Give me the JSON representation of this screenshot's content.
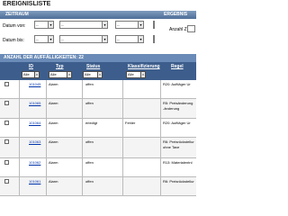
{
  "page_title": "EREIGNISLISTE",
  "filter_bar": {
    "label": "ZEITRAUM",
    "button_label": "",
    "right_label": "ERGEBNIS"
  },
  "date_filter": {
    "from_label": "Datum von:",
    "to_label": "Datum bis:",
    "select_placeholder": "--",
    "anzahl_label": "Anzahl Ze"
  },
  "section": {
    "title": "ANZAHL DER AUFFÄLLIGKEITEN: 22"
  },
  "table": {
    "headers": {
      "id": "ID",
      "typ": "Typ",
      "status": "Status",
      "klassifizierung": "Klassifizierung",
      "regel": "Regel"
    },
    "header_selects": {
      "id": "Alle",
      "typ": "Alle",
      "status": "Alle",
      "klassifizierung": "Alle"
    },
    "rows": [
      {
        "id": "101045",
        "typ": "Alarm",
        "status": "offen",
        "klass": "",
        "regel": "R20: Auftläger Ur",
        "regel2": ""
      },
      {
        "id": "101065",
        "typ": "Alarm",
        "status": "offen",
        "klass": "",
        "regel": "R5: Preisänderung",
        "regel2": "-änderung"
      },
      {
        "id": "101064",
        "typ": "Alarm",
        "status": "erledigt",
        "klass": "Fehler",
        "regel": "R20: Auftläger Ur",
        "regel2": ""
      },
      {
        "id": "101063",
        "typ": "Alarm",
        "status": "offen",
        "klass": "",
        "regel": "R6: Preisrückstellur",
        "regel2": "ohne Tave"
      },
      {
        "id": "101062",
        "typ": "Alarm",
        "status": "offen",
        "klass": "",
        "regel": "R13: Materialentnl",
        "regel2": ""
      },
      {
        "id": "101061",
        "typ": "Alarm",
        "status": "offen",
        "klass": "",
        "regel": "R6: Preisrückstellur",
        "regel2": ""
      }
    ]
  }
}
